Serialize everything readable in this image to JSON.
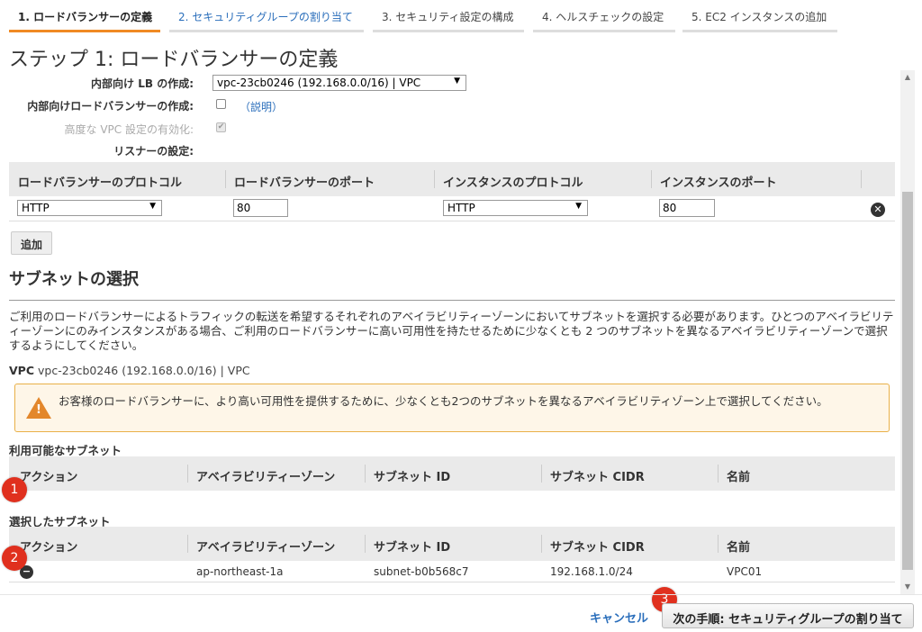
{
  "wizard": {
    "steps": [
      {
        "label": "1. ロードバランサーの定義"
      },
      {
        "label": "2. セキュリティグループの割り当て"
      },
      {
        "label": "3. セキュリティ設定の構成"
      },
      {
        "label": "4. ヘルスチェックの設定"
      },
      {
        "label": "5. EC2 インスタンスの追加"
      }
    ]
  },
  "page": {
    "title": "ステップ 1: ロードバランサーの定義"
  },
  "form": {
    "internal_lb_label": "内部向け LB の作成:",
    "vpc_select_value": "vpc-23cb0246 (192.168.0.0/16) | VPC",
    "internal_lb_create_label": "内部向けロードバランサーの作成:",
    "explain_link": "（説明）",
    "advanced_vpc_label": "高度な VPC 設定の有効化:",
    "listener_label": "リスナーの設定:"
  },
  "listeners": {
    "headers": [
      "ロードバランサーのプロトコル",
      "ロードバランサーのポート",
      "インスタンスのプロトコル",
      "インスタンスのポート"
    ],
    "rows": [
      {
        "lb_protocol": "HTTP",
        "lb_port": "80",
        "instance_protocol": "HTTP",
        "instance_port": "80"
      }
    ],
    "add_button": "追加"
  },
  "subnets": {
    "title": "サブネットの選択",
    "description": "ご利用のロードバランサーによるトラフィックの転送を希望するそれぞれのアベイラビリティーゾーンにおいてサブネットを選択する必要があります。ひとつのアベイラビリティーゾーンにのみインスタンスがある場合、ご利用のロードバランサーに高い可用性を持たせるために少なくとも 2 つのサブネットを異なるアベイラビリティーゾーンで選択するようにしてください。",
    "vpc_label": "VPC",
    "vpc_value": "vpc-23cb0246 (192.168.0.0/16) | VPC",
    "warning": "お客様のロードバランサーに、より高い可用性を提供するために、少なくとも2つのサブネットを異なるアベイラビリティゾーン上で選択してください。",
    "available_title": "利用可能なサブネット",
    "selected_title": "選択したサブネット",
    "columns": [
      "アクション",
      "アベイラビリティーゾーン",
      "サブネット ID",
      "サブネット CIDR",
      "名前"
    ],
    "selected_rows": [
      {
        "az": "ap-northeast-1a",
        "subnet_id": "subnet-b0b568c7",
        "cidr": "192.168.1.0/24",
        "name": "VPC01"
      }
    ]
  },
  "badges": [
    "1",
    "2",
    "3"
  ],
  "footer": {
    "cancel": "キャンセル",
    "next": "次の手順: セキュリティグループの割り当て"
  },
  "colors": {
    "active_step": "#f08a24",
    "link": "#2a6ebb",
    "badge": "#e0301e",
    "warning_border": "#e9b048",
    "warning_icon": "#e3872b"
  }
}
